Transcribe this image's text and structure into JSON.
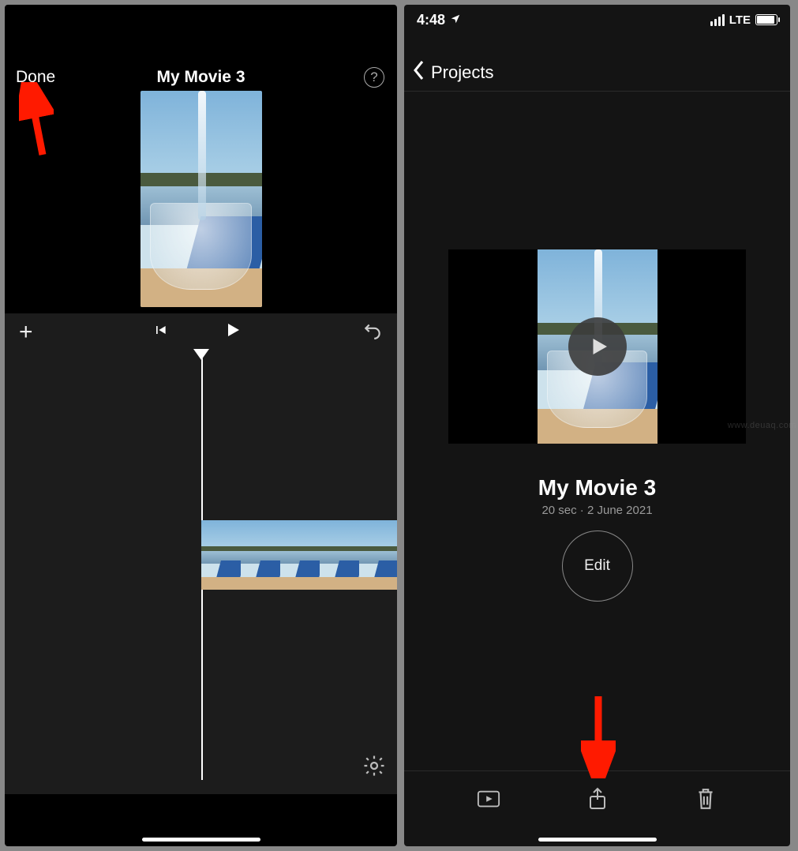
{
  "left": {
    "done_label": "Done",
    "title": "My Movie 3",
    "help_glyph": "?",
    "add_glyph": "+"
  },
  "right": {
    "status": {
      "time": "4:48",
      "carrier": "LTE"
    },
    "nav_back_label": "Projects",
    "project_title": "My Movie 3",
    "project_subtitle": "20 sec · 2 June 2021",
    "edit_label": "Edit"
  },
  "watermark": "www.deuaq.com"
}
